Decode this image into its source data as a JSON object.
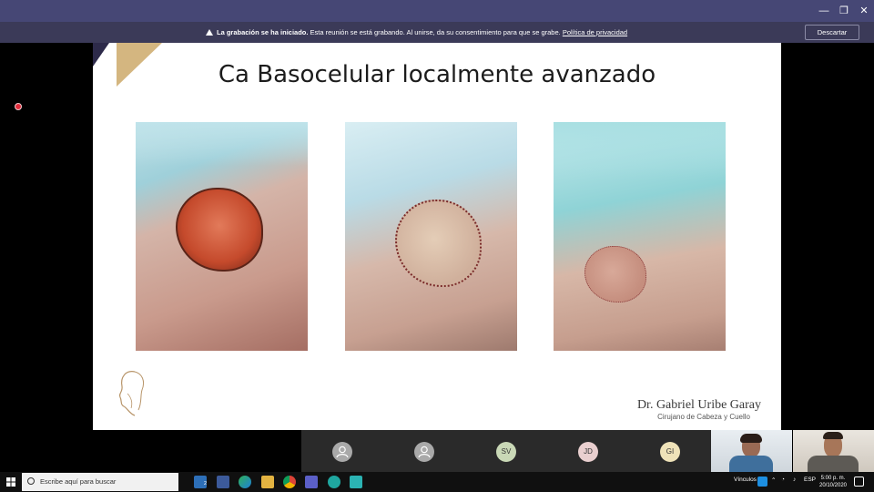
{
  "banner": {
    "bold_text": "La grabación se ha iniciado.",
    "text": " Esta reunión se está grabando. Al unirse, da su consentimiento para que se grabe. ",
    "link": "Política de privacidad",
    "dismiss_label": "Descartar"
  },
  "window": {
    "minimize": "—",
    "maximize": "❐",
    "close": "✕"
  },
  "slide": {
    "title": "Ca Basocelular localmente avanzado",
    "author": "Dr. Gabriel Uribe Garay",
    "author_role": "Cirujano de Cabeza y Cuello"
  },
  "participants": [
    {
      "kind": "icon",
      "initials": ""
    },
    {
      "kind": "icon",
      "initials": ""
    },
    {
      "kind": "initials",
      "initials": "SV",
      "color": "#c9d8b6"
    },
    {
      "kind": "initials",
      "initials": "JD",
      "color": "#e9cfcf"
    },
    {
      "kind": "initials",
      "initials": "GI",
      "color": "#efe2b8"
    }
  ],
  "taskbar": {
    "search_placeholder": "Escribe aquí para buscar",
    "links_label": "Vínculos",
    "lang": "ESP",
    "time": "5:00 p. m.",
    "date": "20/10/2020",
    "mail_badge": "2"
  },
  "colors": {
    "teams_purple": "#464775",
    "banner": "#3b3a58",
    "gold": "#d4b680"
  }
}
